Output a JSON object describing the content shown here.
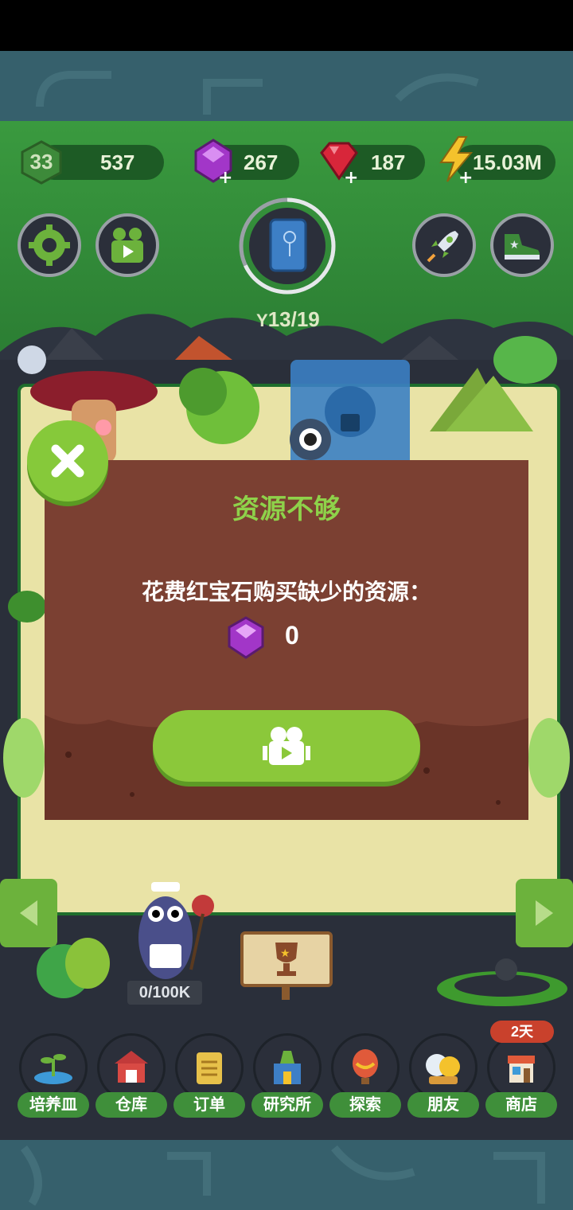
{
  "stats": {
    "level": "33",
    "coins": "537",
    "gems": "267",
    "rubies": "187",
    "energy": "15.03M"
  },
  "progress": {
    "label": "13/19",
    "fraction": 0.68
  },
  "dialog": {
    "title": "资源不够",
    "message": "花费红宝石购买缺少的资源：",
    "cost": "0"
  },
  "maid": {
    "counter": "0/100K"
  },
  "tabs": [
    {
      "label": "培养皿",
      "icon": "petri-dish-icon"
    },
    {
      "label": "仓库",
      "icon": "barn-icon"
    },
    {
      "label": "订单",
      "icon": "scroll-icon"
    },
    {
      "label": "研究所",
      "icon": "lab-icon"
    },
    {
      "label": "探索",
      "icon": "balloon-icon"
    },
    {
      "label": "朋友",
      "icon": "friends-icon"
    },
    {
      "label": "商店",
      "icon": "shop-icon"
    }
  ],
  "shop_badge": "2天",
  "colors": {
    "accent_green": "#8bc83a",
    "dialog_brown": "#7b4032",
    "ruby": "#d8263a",
    "gem": "#a236c8"
  }
}
